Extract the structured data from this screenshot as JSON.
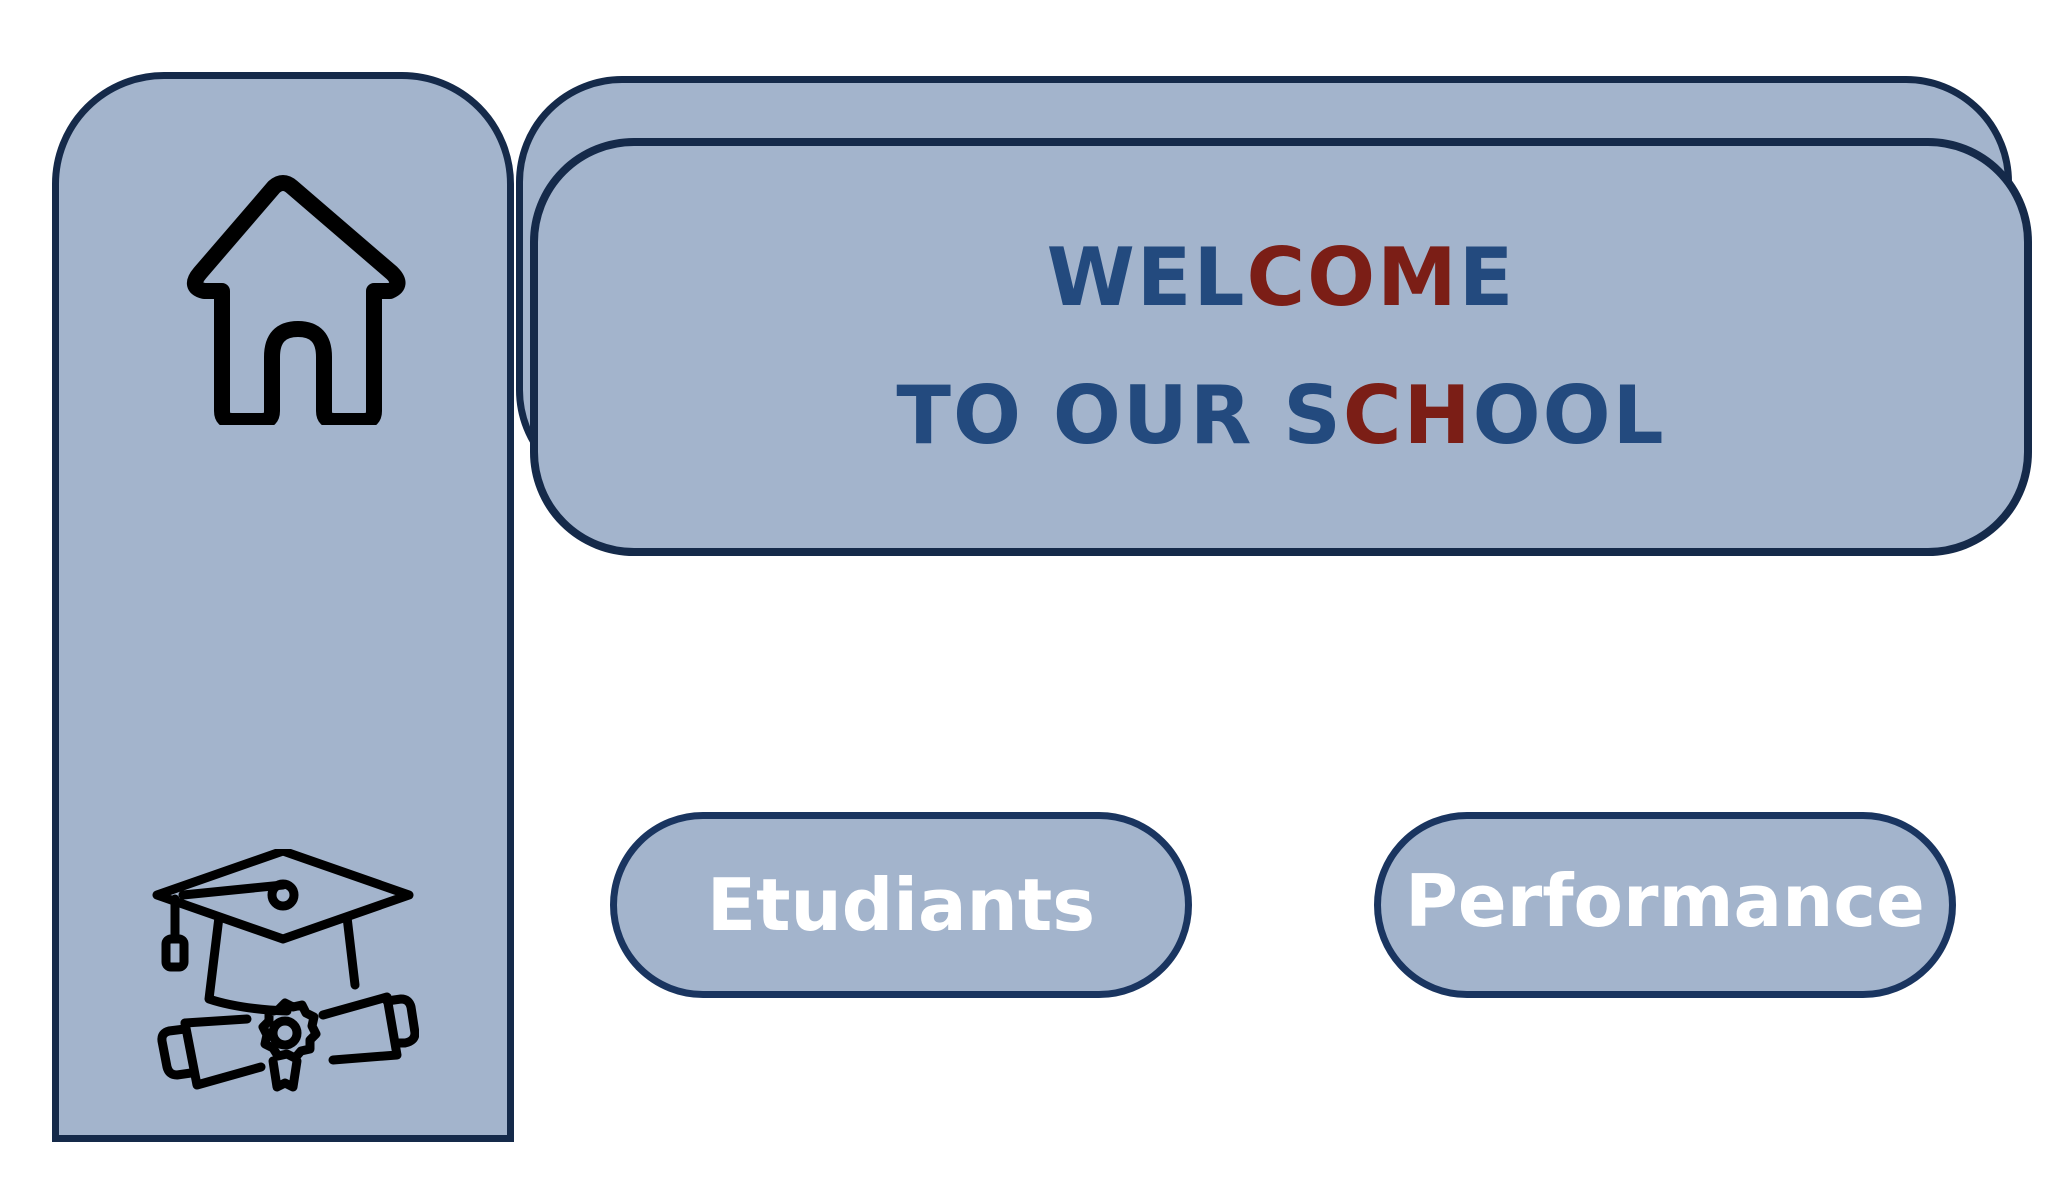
{
  "sidebar": {
    "items": [
      {
        "name": "home",
        "icon": "home-icon"
      },
      {
        "name": "graduation",
        "icon": "graduation-cap-diploma-icon"
      }
    ]
  },
  "banner": {
    "line1_a": "WEL",
    "line1_b": "COM",
    "line1_c": "E",
    "line2_a": "TO OUR S",
    "line2_b": "CH",
    "line2_c": "OOL"
  },
  "buttons": {
    "etudiants": "Etudiants",
    "performance": "Performance"
  },
  "colors": {
    "panel_fill": "#a3b4cc",
    "border": "#152a4a",
    "title_blue": "#234a7e",
    "title_red": "#7b1e16",
    "button_text": "#ffffff"
  }
}
